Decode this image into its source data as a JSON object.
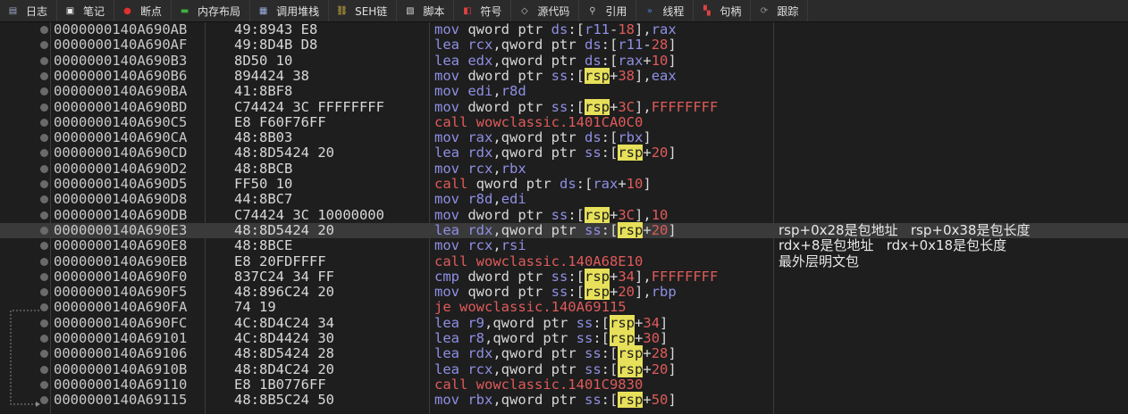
{
  "tabs": [
    {
      "label": "日志",
      "icon": "log-icon",
      "color": "#9aa8c8"
    },
    {
      "label": "笔记",
      "icon": "note-icon",
      "color": "#e8e8e8"
    },
    {
      "label": "断点",
      "icon": "breakpoint-icon",
      "color": "#e03030"
    },
    {
      "label": "内存布局",
      "icon": "memory-map-icon",
      "color": "#40b040"
    },
    {
      "label": "调用堆栈",
      "icon": "call-stack-icon",
      "color": "#9ab0e0"
    },
    {
      "label": "SEH链",
      "icon": "seh-chain-icon",
      "color": "#e0c040"
    },
    {
      "label": "脚本",
      "icon": "script-icon",
      "color": "#d0d0d0"
    },
    {
      "label": "符号",
      "icon": "symbol-icon",
      "color": "#e04040"
    },
    {
      "label": "源代码",
      "icon": "source-icon",
      "color": "#c0c0c0"
    },
    {
      "label": "引用",
      "icon": "reference-icon",
      "color": "#c0c0c0"
    },
    {
      "label": "线程",
      "icon": "thread-icon",
      "color": "#5080e0"
    },
    {
      "label": "句柄",
      "icon": "handle-icon",
      "color": "#e04040"
    },
    {
      "label": "跟踪",
      "icon": "trace-icon",
      "color": "#909090"
    }
  ],
  "rows": [
    {
      "addr": "0000000140A690AB",
      "bytes": "49:8943 E8",
      "asm": [
        [
          "mov",
          "m"
        ],
        [
          " qword ptr ",
          "o"
        ],
        [
          "ds",
          "r"
        ],
        [
          ":[",
          "o"
        ],
        [
          "r11",
          "r"
        ],
        [
          "-",
          "o"
        ],
        [
          "18",
          "n"
        ],
        [
          "],",
          "o"
        ],
        [
          "rax",
          "r"
        ]
      ]
    },
    {
      "addr": "0000000140A690AF",
      "bytes": "49:8D4B D8",
      "asm": [
        [
          "lea",
          "m"
        ],
        [
          " ",
          "o"
        ],
        [
          "rcx",
          "r"
        ],
        [
          ",qword ptr ",
          "o"
        ],
        [
          "ds",
          "r"
        ],
        [
          ":[",
          "o"
        ],
        [
          "r11",
          "r"
        ],
        [
          "-",
          "o"
        ],
        [
          "28",
          "n"
        ],
        [
          "]",
          "o"
        ]
      ]
    },
    {
      "addr": "0000000140A690B3",
      "bytes": "8D50 10",
      "asm": [
        [
          "lea",
          "m"
        ],
        [
          " ",
          "o"
        ],
        [
          "edx",
          "r"
        ],
        [
          ",qword ptr ",
          "o"
        ],
        [
          "ds",
          "r"
        ],
        [
          ":[",
          "o"
        ],
        [
          "rax",
          "r"
        ],
        [
          "+",
          "o"
        ],
        [
          "10",
          "n"
        ],
        [
          "]",
          "o"
        ]
      ]
    },
    {
      "addr": "0000000140A690B6",
      "bytes": "894424 38",
      "asm": [
        [
          "mov",
          "m"
        ],
        [
          " dword ptr ",
          "o"
        ],
        [
          "ss",
          "r"
        ],
        [
          ":[",
          "o"
        ],
        [
          "rsp",
          "s"
        ],
        [
          "+",
          "o"
        ],
        [
          "38",
          "n"
        ],
        [
          "],",
          "o"
        ],
        [
          "eax",
          "r"
        ]
      ]
    },
    {
      "addr": "0000000140A690BA",
      "bytes": "41:8BF8",
      "asm": [
        [
          "mov",
          "m"
        ],
        [
          " ",
          "o"
        ],
        [
          "edi",
          "r"
        ],
        [
          ",",
          "o"
        ],
        [
          "r8d",
          "r"
        ]
      ]
    },
    {
      "addr": "0000000140A690BD",
      "bytes": "C74424 3C FFFFFFFF",
      "asm": [
        [
          "mov",
          "m"
        ],
        [
          " dword ptr ",
          "o"
        ],
        [
          "ss",
          "r"
        ],
        [
          ":[",
          "o"
        ],
        [
          "rsp",
          "s"
        ],
        [
          "+",
          "o"
        ],
        [
          "3C",
          "n"
        ],
        [
          "],",
          "o"
        ],
        [
          "FFFFFFFF",
          "n"
        ]
      ]
    },
    {
      "addr": "0000000140A690C5",
      "bytes": "E8 F60F76FF",
      "asm": [
        [
          "call wowclassic.1401CA0C0",
          "c"
        ]
      ]
    },
    {
      "addr": "0000000140A690CA",
      "bytes": "48:8B03",
      "asm": [
        [
          "mov",
          "m"
        ],
        [
          " ",
          "o"
        ],
        [
          "rax",
          "r"
        ],
        [
          ",qword ptr ",
          "o"
        ],
        [
          "ds",
          "r"
        ],
        [
          ":[",
          "o"
        ],
        [
          "rbx",
          "r"
        ],
        [
          "]",
          "o"
        ]
      ]
    },
    {
      "addr": "0000000140A690CD",
      "bytes": "48:8D5424 20",
      "asm": [
        [
          "lea",
          "m"
        ],
        [
          " ",
          "o"
        ],
        [
          "rdx",
          "r"
        ],
        [
          ",qword ptr ",
          "o"
        ],
        [
          "ss",
          "r"
        ],
        [
          ":[",
          "o"
        ],
        [
          "rsp",
          "s"
        ],
        [
          "+",
          "o"
        ],
        [
          "20",
          "n"
        ],
        [
          "]",
          "o"
        ]
      ]
    },
    {
      "addr": "0000000140A690D2",
      "bytes": "48:8BCB",
      "asm": [
        [
          "mov",
          "m"
        ],
        [
          " ",
          "o"
        ],
        [
          "rcx",
          "r"
        ],
        [
          ",",
          "o"
        ],
        [
          "rbx",
          "r"
        ]
      ]
    },
    {
      "addr": "0000000140A690D5",
      "bytes": "FF50 10",
      "asm": [
        [
          "call",
          "c"
        ],
        [
          " qword ptr ",
          "o"
        ],
        [
          "ds",
          "r"
        ],
        [
          ":[",
          "o"
        ],
        [
          "rax",
          "r"
        ],
        [
          "+",
          "o"
        ],
        [
          "10",
          "n"
        ],
        [
          "]",
          "o"
        ]
      ]
    },
    {
      "addr": "0000000140A690D8",
      "bytes": "44:8BC7",
      "asm": [
        [
          "mov",
          "m"
        ],
        [
          " ",
          "o"
        ],
        [
          "r8d",
          "r"
        ],
        [
          ",",
          "o"
        ],
        [
          "edi",
          "r"
        ]
      ]
    },
    {
      "addr": "0000000140A690DB",
      "bytes": "C74424 3C 10000000",
      "asm": [
        [
          "mov",
          "m"
        ],
        [
          " dword ptr ",
          "o"
        ],
        [
          "ss",
          "r"
        ],
        [
          ":[",
          "o"
        ],
        [
          "rsp",
          "s"
        ],
        [
          "+",
          "o"
        ],
        [
          "3C",
          "n"
        ],
        [
          "],",
          "o"
        ],
        [
          "10",
          "n"
        ]
      ]
    },
    {
      "addr": "0000000140A690E3",
      "bytes": "48:8D5424 20",
      "asm": [
        [
          "lea",
          "m"
        ],
        [
          " ",
          "o"
        ],
        [
          "rdx",
          "r"
        ],
        [
          ",qword ptr ",
          "o"
        ],
        [
          "ss",
          "r"
        ],
        [
          ":[",
          "o"
        ],
        [
          "rsp",
          "s"
        ],
        [
          "+",
          "o"
        ],
        [
          "20",
          "n"
        ],
        [
          "]",
          "o"
        ]
      ],
      "comment": "rsp+0x28是包地址   rsp+0x38是包长度",
      "selected": true
    },
    {
      "addr": "0000000140A690E8",
      "bytes": "48:8BCE",
      "asm": [
        [
          "mov",
          "m"
        ],
        [
          " ",
          "o"
        ],
        [
          "rcx",
          "r"
        ],
        [
          ",",
          "o"
        ],
        [
          "rsi",
          "r"
        ]
      ],
      "comment": "rdx+8是包地址   rdx+0x18是包长度"
    },
    {
      "addr": "0000000140A690EB",
      "bytes": "E8 20FDFFFF",
      "asm": [
        [
          "call wowclassic.140A68E10",
          "c"
        ]
      ],
      "comment": "最外层明文包"
    },
    {
      "addr": "0000000140A690F0",
      "bytes": "837C24 34 FF",
      "asm": [
        [
          "cmp",
          "m"
        ],
        [
          " dword ptr ",
          "o"
        ],
        [
          "ss",
          "r"
        ],
        [
          ":[",
          "o"
        ],
        [
          "rsp",
          "s"
        ],
        [
          "+",
          "o"
        ],
        [
          "34",
          "n"
        ],
        [
          "],",
          "o"
        ],
        [
          "FFFFFFFF",
          "n"
        ]
      ]
    },
    {
      "addr": "0000000140A690F5",
      "bytes": "48:896C24 20",
      "asm": [
        [
          "mov",
          "m"
        ],
        [
          " qword ptr ",
          "o"
        ],
        [
          "ss",
          "r"
        ],
        [
          ":[",
          "o"
        ],
        [
          "rsp",
          "s"
        ],
        [
          "+",
          "o"
        ],
        [
          "20",
          "n"
        ],
        [
          "],",
          "o"
        ],
        [
          "rbp",
          "r"
        ]
      ]
    },
    {
      "addr": "0000000140A690FA",
      "bytes": "74 19",
      "asm": [
        [
          "je wowclassic.140A69115",
          "c"
        ]
      ]
    },
    {
      "addr": "0000000140A690FC",
      "bytes": "4C:8D4C24 34",
      "asm": [
        [
          "lea",
          "m"
        ],
        [
          " ",
          "o"
        ],
        [
          "r9",
          "r"
        ],
        [
          ",qword ptr ",
          "o"
        ],
        [
          "ss",
          "r"
        ],
        [
          ":[",
          "o"
        ],
        [
          "rsp",
          "s"
        ],
        [
          "+",
          "o"
        ],
        [
          "34",
          "n"
        ],
        [
          "]",
          "o"
        ]
      ]
    },
    {
      "addr": "0000000140A69101",
      "bytes": "4C:8D4424 30",
      "asm": [
        [
          "lea",
          "m"
        ],
        [
          " ",
          "o"
        ],
        [
          "r8",
          "r"
        ],
        [
          ",qword ptr ",
          "o"
        ],
        [
          "ss",
          "r"
        ],
        [
          ":[",
          "o"
        ],
        [
          "rsp",
          "s"
        ],
        [
          "+",
          "o"
        ],
        [
          "30",
          "n"
        ],
        [
          "]",
          "o"
        ]
      ]
    },
    {
      "addr": "0000000140A69106",
      "bytes": "48:8D5424 28",
      "asm": [
        [
          "lea",
          "m"
        ],
        [
          " ",
          "o"
        ],
        [
          "rdx",
          "r"
        ],
        [
          ",qword ptr ",
          "o"
        ],
        [
          "ss",
          "r"
        ],
        [
          ":[",
          "o"
        ],
        [
          "rsp",
          "s"
        ],
        [
          "+",
          "o"
        ],
        [
          "28",
          "n"
        ],
        [
          "]",
          "o"
        ]
      ]
    },
    {
      "addr": "0000000140A6910B",
      "bytes": "48:8D4C24 20",
      "asm": [
        [
          "lea",
          "m"
        ],
        [
          " ",
          "o"
        ],
        [
          "rcx",
          "r"
        ],
        [
          ",qword ptr ",
          "o"
        ],
        [
          "ss",
          "r"
        ],
        [
          ":[",
          "o"
        ],
        [
          "rsp",
          "s"
        ],
        [
          "+",
          "o"
        ],
        [
          "20",
          "n"
        ],
        [
          "]",
          "o"
        ]
      ]
    },
    {
      "addr": "0000000140A69110",
      "bytes": "E8 1B0776FF",
      "asm": [
        [
          "call wowclassic.1401C9830",
          "c"
        ]
      ]
    },
    {
      "addr": "0000000140A69115",
      "bytes": "48:8B5C24 50",
      "asm": [
        [
          "mov",
          "m"
        ],
        [
          " ",
          "o"
        ],
        [
          "rbx",
          "r"
        ],
        [
          ",qword ptr ",
          "o"
        ],
        [
          "ss",
          "r"
        ],
        [
          ":[",
          "o"
        ],
        [
          "rsp",
          "s"
        ],
        [
          "+",
          "o"
        ],
        [
          "50",
          "n"
        ],
        [
          "]",
          "o"
        ]
      ]
    }
  ]
}
